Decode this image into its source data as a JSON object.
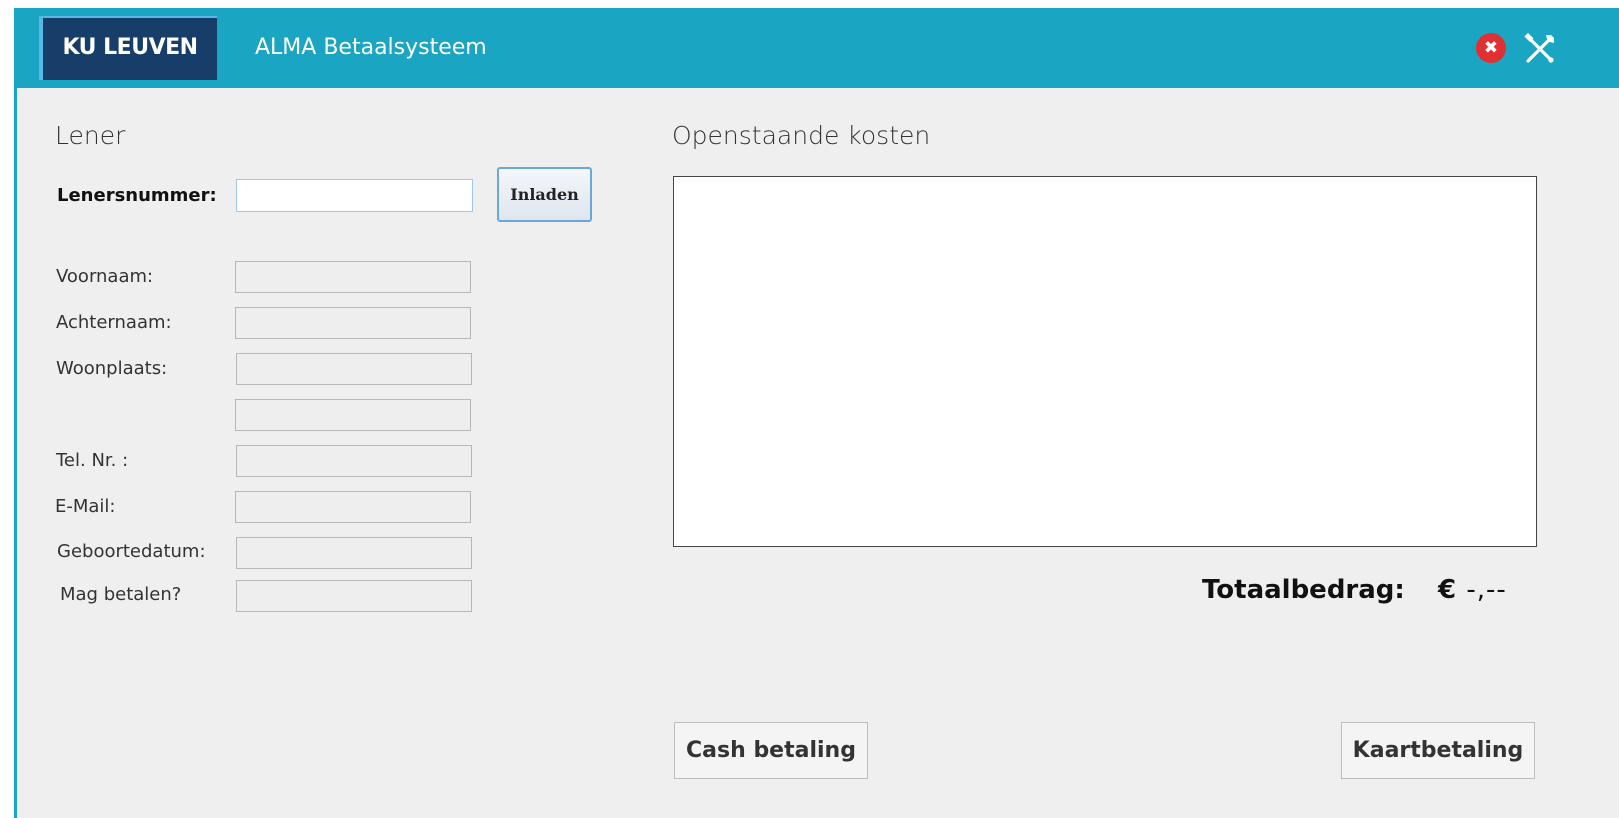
{
  "header": {
    "logo_text": "KU LEUVEN",
    "app_title": "ALMA Betaalsysteem",
    "close_icon": "✖",
    "tools_icon": "tools-icon",
    "bg_color": "#1aa5c3"
  },
  "lener": {
    "title": "Lener",
    "lenersnummer_label": "Lenersnummer:",
    "lenersnummer_value": "",
    "load_button": "Inladen",
    "fields": [
      {
        "label": "Voornaam:",
        "value": ""
      },
      {
        "label": "Achternaam:",
        "value": ""
      },
      {
        "label": "Woonplaats:",
        "value": ""
      },
      {
        "label": "",
        "value": ""
      },
      {
        "label": "Tel. Nr. :",
        "value": ""
      },
      {
        "label": "E-Mail:",
        "value": ""
      },
      {
        "label": "Geboortedatum:",
        "value": ""
      },
      {
        "label": "Mag betalen?",
        "value": ""
      }
    ]
  },
  "costs": {
    "title": "Openstaande kosten",
    "items": [],
    "total_label": "Totaalbedrag:",
    "currency": "€",
    "total_value": "-,--"
  },
  "actions": {
    "cash_label": "Cash betaling",
    "card_label": "Kaartbetaling"
  }
}
